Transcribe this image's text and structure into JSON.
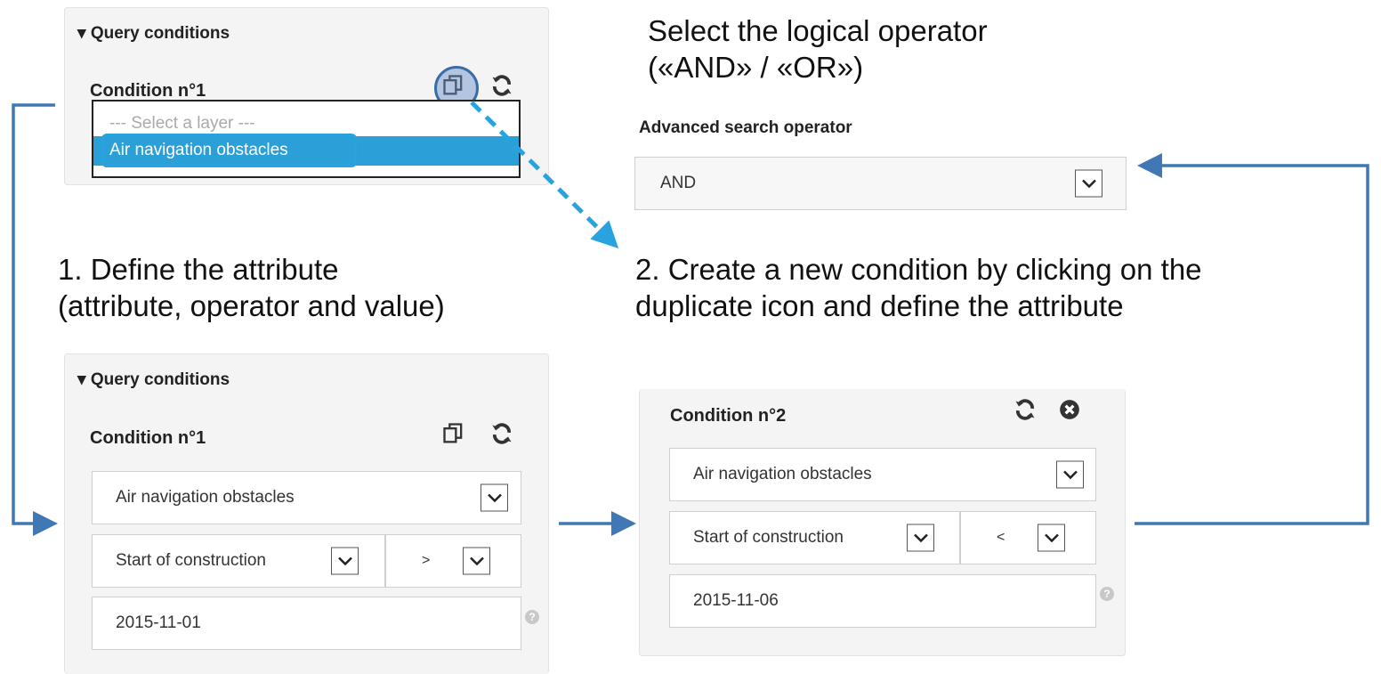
{
  "top_left": {
    "panel_title": "Query conditions",
    "condition_title": "Condition n°1",
    "layer_options": [
      "--- Select a layer ---",
      "Air navigation obstacles"
    ]
  },
  "operator": {
    "caption_line1": "Select the logical operator",
    "caption_line2": "(«AND» / «OR»)",
    "label": "Advanced search operator",
    "value": "AND"
  },
  "step1": {
    "caption_line1": "1. Define the attribute",
    "caption_line2": "(attribute, operator and value)"
  },
  "step2": {
    "caption_line1": "2. Create a new condition by clicking on the",
    "caption_line2": "duplicate icon and define the attribute"
  },
  "bottom_left": {
    "panel_title": "Query conditions",
    "condition_title": "Condition n°1",
    "layer": "Air navigation obstacles",
    "attribute": "Start of construction",
    "comparison": ">",
    "value": "2015-11-01",
    "help": "?"
  },
  "bottom_right": {
    "condition_title": "Condition n°2",
    "layer": "Air navigation obstacles",
    "attribute": "Start of construction",
    "comparison": "<",
    "value": "2015-11-06",
    "help": "?"
  },
  "colors": {
    "accent": "#2a9fd8",
    "arrow": "#3f78b5",
    "highlight_box": "#29a3df"
  }
}
